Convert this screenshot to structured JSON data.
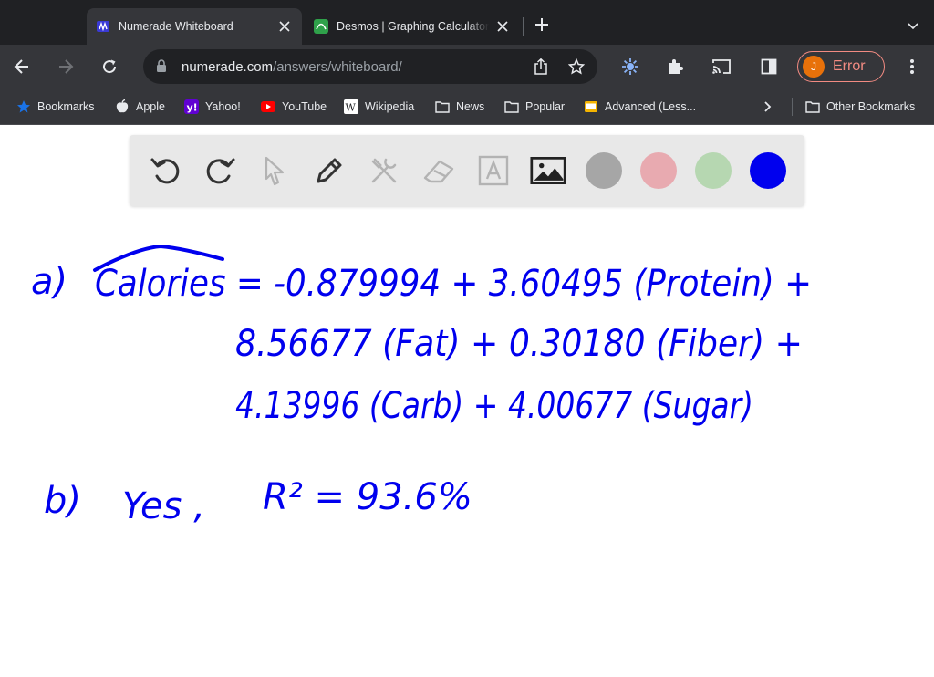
{
  "browser": {
    "tabs": [
      {
        "title": "Numerade Whiteboard",
        "active": true
      },
      {
        "title": "Desmos | Graphing Calculator",
        "active": false
      }
    ],
    "url_host": "numerade.com",
    "url_path": "/answers/whiteboard/",
    "profile_initial": "J",
    "profile_status": "Error"
  },
  "bookmarks": [
    {
      "label": "Bookmarks",
      "icon": "star-icon"
    },
    {
      "label": "Apple",
      "icon": "apple-icon"
    },
    {
      "label": "Yahoo!",
      "icon": "yahoo-icon"
    },
    {
      "label": "YouTube",
      "icon": "youtube-icon"
    },
    {
      "label": "Wikipedia",
      "icon": "wikipedia-icon"
    },
    {
      "label": "News",
      "icon": "folder-icon"
    },
    {
      "label": "Popular",
      "icon": "folder-icon"
    },
    {
      "label": "Advanced (Less...",
      "icon": "bookmark-icon"
    },
    {
      "label": "Other Bookmarks",
      "icon": "folder-icon"
    }
  ],
  "whiteboard": {
    "tools": [
      "undo-icon",
      "redo-icon",
      "pointer-icon",
      "pen-icon",
      "tools-icon",
      "eraser-icon",
      "text-icon",
      "image-icon"
    ],
    "colors": [
      "#a6a6a6",
      "#e8aab0",
      "#b6d7b1",
      "#0000ee"
    ],
    "ink_color": "#0000ee",
    "handwriting": {
      "a_label": "a)",
      "a_line1": "Calories = -0.879994 + 3.60495 (Protein) +",
      "a_line2": "8.56677 (Fat) + 0.30180 (Fiber) +",
      "a_line3": "4.13996 (Carb) + 4.00677 (Sugar)",
      "b_label": "b)",
      "b_answer": "Yes ,",
      "b_r2": "R² = 93.6%"
    }
  }
}
